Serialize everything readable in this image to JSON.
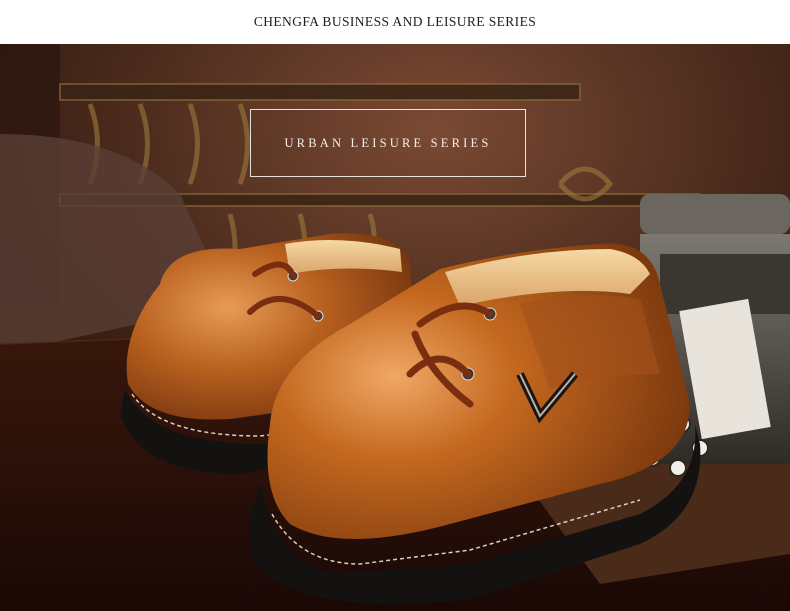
{
  "header": {
    "title": "CHENGFA BUSINESS AND LEISURE SERIES"
  },
  "banner": {
    "series_label": "URBAN LEISURE SERIES"
  },
  "photo": {
    "subject": "shoes-icon",
    "colors": {
      "leather": "#b3561c",
      "sole": "#141111",
      "background_wall": "#4a2a1c",
      "table": "#2b1109"
    }
  }
}
